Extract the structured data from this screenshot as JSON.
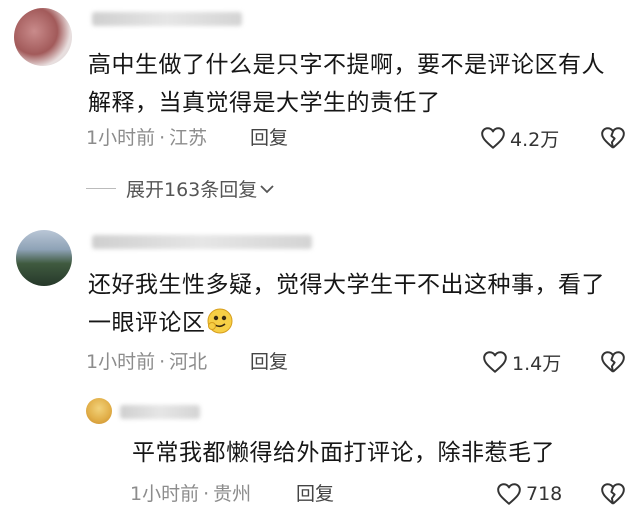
{
  "comments": [
    {
      "text_line1": "高中生做了什么是只字不提啊，要不是评论区有人",
      "text_line2": "解释，当真觉得是大学生的责任了",
      "time": "1小时前",
      "location": "江苏",
      "reply": "回复",
      "likes": "4.2万",
      "expand": "展开163条回复"
    },
    {
      "text_line1": "还好我生性多疑，觉得大学生干不出这种事，看了",
      "text_line2": "一眼评论区",
      "time": "1小时前",
      "location": "河北",
      "reply": "回复",
      "likes": "1.4万"
    },
    {
      "text_line1": "平常我都懒得给外面打评论，除非惹毛了",
      "time": "1小时前",
      "location": "贵州",
      "reply": "回复",
      "likes": "718"
    }
  ],
  "icons": {
    "like": "heart-outline-icon",
    "dislike": "broken-heart-icon",
    "expand": "chevron-down-icon",
    "emoji": "thinking-face-emoji"
  }
}
